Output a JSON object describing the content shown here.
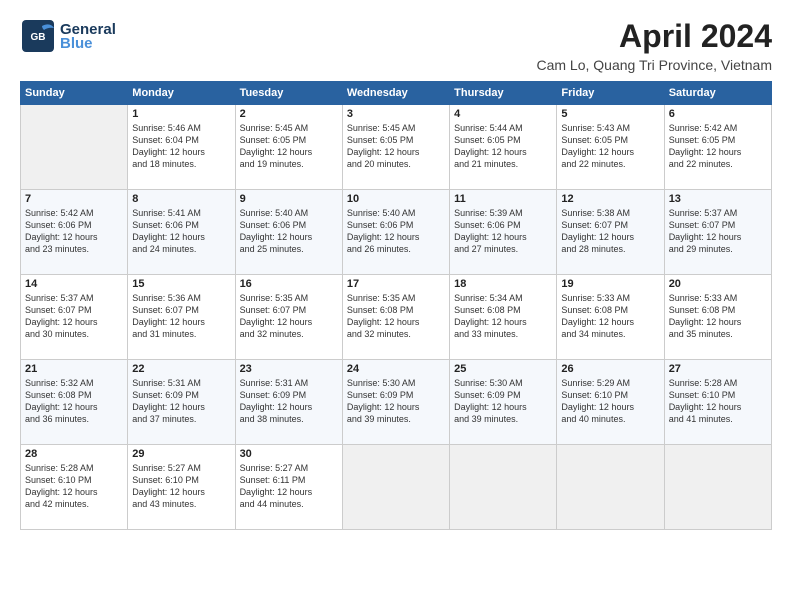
{
  "header": {
    "logo_line1": "General",
    "logo_line2": "Blue",
    "title": "April 2024",
    "subtitle": "Cam Lo, Quang Tri Province, Vietnam"
  },
  "weekdays": [
    "Sunday",
    "Monday",
    "Tuesday",
    "Wednesday",
    "Thursday",
    "Friday",
    "Saturday"
  ],
  "weeks": [
    [
      {
        "day": "",
        "content": ""
      },
      {
        "day": "1",
        "content": "Sunrise: 5:46 AM\nSunset: 6:04 PM\nDaylight: 12 hours\nand 18 minutes."
      },
      {
        "day": "2",
        "content": "Sunrise: 5:45 AM\nSunset: 6:05 PM\nDaylight: 12 hours\nand 19 minutes."
      },
      {
        "day": "3",
        "content": "Sunrise: 5:45 AM\nSunset: 6:05 PM\nDaylight: 12 hours\nand 20 minutes."
      },
      {
        "day": "4",
        "content": "Sunrise: 5:44 AM\nSunset: 6:05 PM\nDaylight: 12 hours\nand 21 minutes."
      },
      {
        "day": "5",
        "content": "Sunrise: 5:43 AM\nSunset: 6:05 PM\nDaylight: 12 hours\nand 22 minutes."
      },
      {
        "day": "6",
        "content": "Sunrise: 5:42 AM\nSunset: 6:05 PM\nDaylight: 12 hours\nand 22 minutes."
      }
    ],
    [
      {
        "day": "7",
        "content": "Sunrise: 5:42 AM\nSunset: 6:06 PM\nDaylight: 12 hours\nand 23 minutes."
      },
      {
        "day": "8",
        "content": "Sunrise: 5:41 AM\nSunset: 6:06 PM\nDaylight: 12 hours\nand 24 minutes."
      },
      {
        "day": "9",
        "content": "Sunrise: 5:40 AM\nSunset: 6:06 PM\nDaylight: 12 hours\nand 25 minutes."
      },
      {
        "day": "10",
        "content": "Sunrise: 5:40 AM\nSunset: 6:06 PM\nDaylight: 12 hours\nand 26 minutes."
      },
      {
        "day": "11",
        "content": "Sunrise: 5:39 AM\nSunset: 6:06 PM\nDaylight: 12 hours\nand 27 minutes."
      },
      {
        "day": "12",
        "content": "Sunrise: 5:38 AM\nSunset: 6:07 PM\nDaylight: 12 hours\nand 28 minutes."
      },
      {
        "day": "13",
        "content": "Sunrise: 5:37 AM\nSunset: 6:07 PM\nDaylight: 12 hours\nand 29 minutes."
      }
    ],
    [
      {
        "day": "14",
        "content": "Sunrise: 5:37 AM\nSunset: 6:07 PM\nDaylight: 12 hours\nand 30 minutes."
      },
      {
        "day": "15",
        "content": "Sunrise: 5:36 AM\nSunset: 6:07 PM\nDaylight: 12 hours\nand 31 minutes."
      },
      {
        "day": "16",
        "content": "Sunrise: 5:35 AM\nSunset: 6:07 PM\nDaylight: 12 hours\nand 32 minutes."
      },
      {
        "day": "17",
        "content": "Sunrise: 5:35 AM\nSunset: 6:08 PM\nDaylight: 12 hours\nand 32 minutes."
      },
      {
        "day": "18",
        "content": "Sunrise: 5:34 AM\nSunset: 6:08 PM\nDaylight: 12 hours\nand 33 minutes."
      },
      {
        "day": "19",
        "content": "Sunrise: 5:33 AM\nSunset: 6:08 PM\nDaylight: 12 hours\nand 34 minutes."
      },
      {
        "day": "20",
        "content": "Sunrise: 5:33 AM\nSunset: 6:08 PM\nDaylight: 12 hours\nand 35 minutes."
      }
    ],
    [
      {
        "day": "21",
        "content": "Sunrise: 5:32 AM\nSunset: 6:08 PM\nDaylight: 12 hours\nand 36 minutes."
      },
      {
        "day": "22",
        "content": "Sunrise: 5:31 AM\nSunset: 6:09 PM\nDaylight: 12 hours\nand 37 minutes."
      },
      {
        "day": "23",
        "content": "Sunrise: 5:31 AM\nSunset: 6:09 PM\nDaylight: 12 hours\nand 38 minutes."
      },
      {
        "day": "24",
        "content": "Sunrise: 5:30 AM\nSunset: 6:09 PM\nDaylight: 12 hours\nand 39 minutes."
      },
      {
        "day": "25",
        "content": "Sunrise: 5:30 AM\nSunset: 6:09 PM\nDaylight: 12 hours\nand 39 minutes."
      },
      {
        "day": "26",
        "content": "Sunrise: 5:29 AM\nSunset: 6:10 PM\nDaylight: 12 hours\nand 40 minutes."
      },
      {
        "day": "27",
        "content": "Sunrise: 5:28 AM\nSunset: 6:10 PM\nDaylight: 12 hours\nand 41 minutes."
      }
    ],
    [
      {
        "day": "28",
        "content": "Sunrise: 5:28 AM\nSunset: 6:10 PM\nDaylight: 12 hours\nand 42 minutes."
      },
      {
        "day": "29",
        "content": "Sunrise: 5:27 AM\nSunset: 6:10 PM\nDaylight: 12 hours\nand 43 minutes."
      },
      {
        "day": "30",
        "content": "Sunrise: 5:27 AM\nSunset: 6:11 PM\nDaylight: 12 hours\nand 44 minutes."
      },
      {
        "day": "",
        "content": ""
      },
      {
        "day": "",
        "content": ""
      },
      {
        "day": "",
        "content": ""
      },
      {
        "day": "",
        "content": ""
      }
    ]
  ]
}
